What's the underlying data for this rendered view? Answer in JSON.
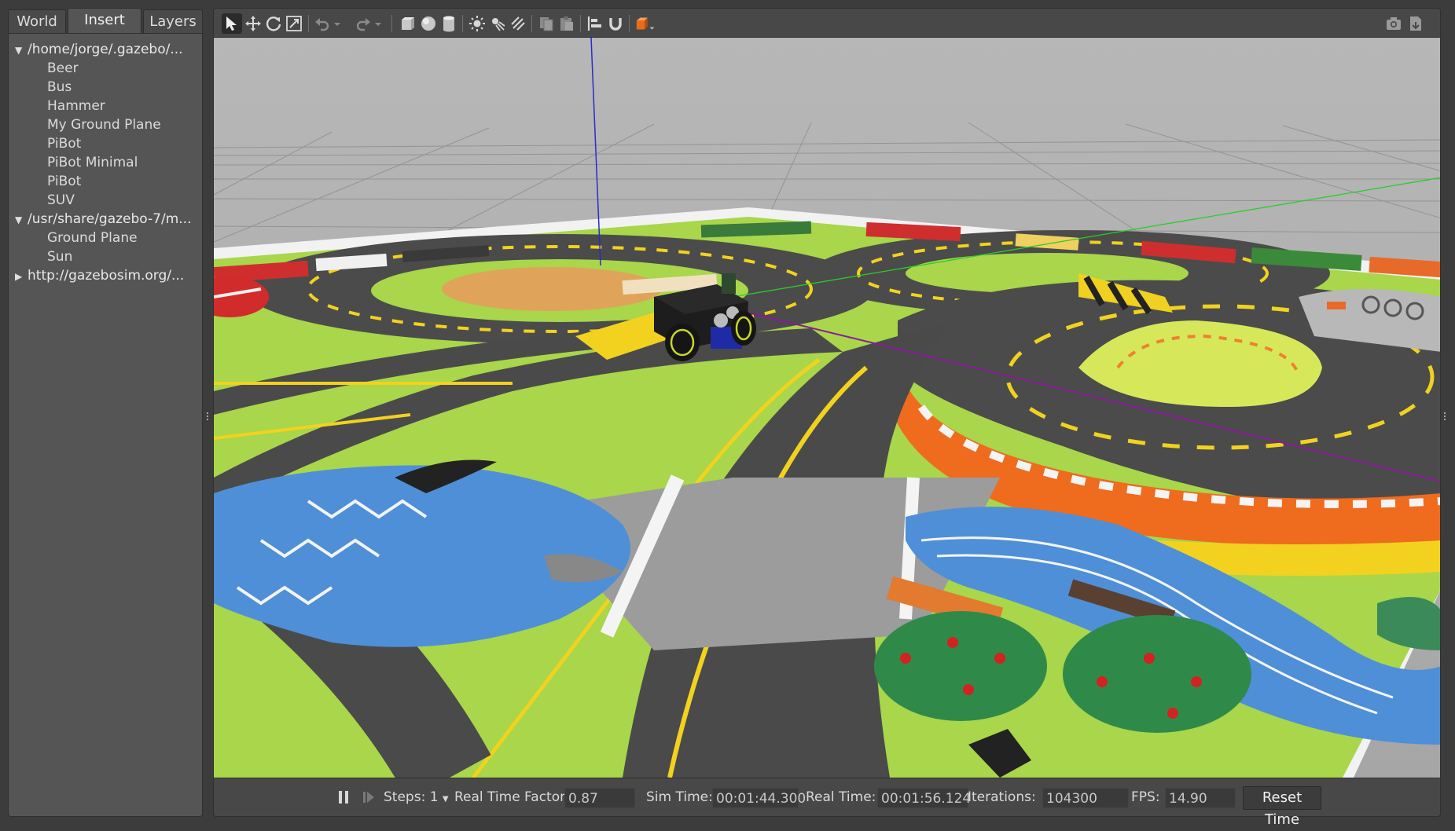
{
  "tabs": [
    {
      "label": "World"
    },
    {
      "label": "Insert"
    },
    {
      "label": "Layers"
    }
  ],
  "active_tab": "Insert",
  "tree": {
    "groups": [
      {
        "path": "/home/jorge/.gazebo/...",
        "expanded": true,
        "items": [
          "Beer",
          "Bus",
          "Hammer",
          "My Ground Plane",
          "PiBot",
          "PiBot Minimal",
          "PiBot",
          "SUV"
        ]
      },
      {
        "path": "/usr/share/gazebo-7/m...",
        "expanded": true,
        "items": [
          "Ground Plane",
          "Sun"
        ]
      },
      {
        "path": "http://gazebosim.org/...",
        "expanded": false,
        "items": []
      }
    ]
  },
  "toolbar": {
    "icons": [
      "select-arrow-icon",
      "translate-icon",
      "rotate-icon",
      "scale-icon",
      "undo-icon",
      "undo-dropdown-icon",
      "redo-icon",
      "redo-dropdown-icon",
      "box-icon",
      "sphere-icon",
      "cylinder-icon",
      "point-light-icon",
      "spot-light-icon",
      "directional-light-icon",
      "copy-icon",
      "paste-icon",
      "align-icon",
      "snap-icon",
      "view-angle-icon",
      "screenshot-icon",
      "log-icon"
    ]
  },
  "statusbar": {
    "steps_label": "Steps: 1",
    "rtf_label": "Real Time Factor:",
    "rtf_value": "0.87",
    "sim_time_label": "Sim Time:",
    "sim_time_value": "00:01:44.300",
    "real_time_label": "Real Time:",
    "real_time_value": "00:01:56.124",
    "iterations_label": "Iterations:",
    "iterations_value": "104300",
    "fps_label": "FPS:",
    "fps_value": "14.90",
    "reset_label": "Reset Time"
  },
  "colors": {
    "panel": "#555555",
    "background": "#3c3c3c",
    "toolbar": "#484848",
    "sky": "#b3b3b3",
    "road": "#4a4a4a",
    "grass": "#a8d84a",
    "water": "#4f8fd8",
    "road_line": "#f2d21e",
    "axis_x": "#cc2222",
    "axis_y": "#22cc22",
    "axis_z": "#2222cc"
  }
}
